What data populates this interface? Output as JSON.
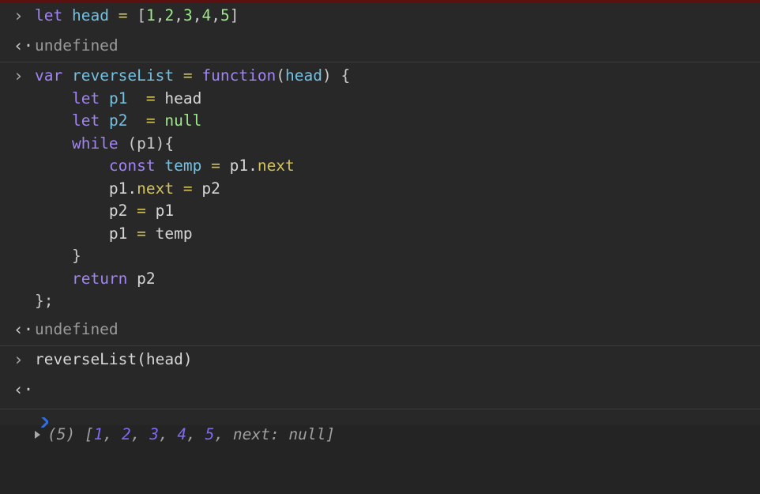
{
  "console": {
    "name": "javascript-console",
    "top_strip_color": "#5c1111",
    "background_color": "#282828",
    "divider_color": "#3b3b3b",
    "prompt_marker": "›",
    "result_marker": "‹·",
    "entries": [
      {
        "id": "entry-1-input",
        "kind": "input",
        "marker": "›",
        "text": "let head = [1,2,3,4,5]",
        "tokens": [
          {
            "t": "let",
            "c": "kw"
          },
          {
            "t": " ",
            "c": "plain"
          },
          {
            "t": "head",
            "c": "ident"
          },
          {
            "t": " ",
            "c": "plain"
          },
          {
            "t": "=",
            "c": "op"
          },
          {
            "t": " ",
            "c": "plain"
          },
          {
            "t": "[",
            "c": "punct"
          },
          {
            "t": "1",
            "c": "num"
          },
          {
            "t": ",",
            "c": "punct"
          },
          {
            "t": "2",
            "c": "num"
          },
          {
            "t": ",",
            "c": "punct"
          },
          {
            "t": "3",
            "c": "num"
          },
          {
            "t": ",",
            "c": "punct"
          },
          {
            "t": "4",
            "c": "num"
          },
          {
            "t": ",",
            "c": "punct"
          },
          {
            "t": "5",
            "c": "num"
          },
          {
            "t": "]",
            "c": "punct"
          }
        ]
      },
      {
        "id": "entry-1-result",
        "kind": "result",
        "marker": "‹·",
        "text": "undefined"
      },
      {
        "id": "entry-2-input",
        "kind": "input",
        "marker": "›",
        "text": "var reverseList = function(head) {\n    let p1  = head\n    let p2  = null\n    while (p1){\n        const temp = p1.next\n        p1.next = p2\n        p2 = p1\n        p1 = temp\n    }\n    return p2\n};",
        "lines": [
          {
            "tokens": [
              {
                "t": "var",
                "c": "kw"
              },
              {
                "t": " ",
                "c": "plain"
              },
              {
                "t": "reverseList",
                "c": "ident"
              },
              {
                "t": " ",
                "c": "plain"
              },
              {
                "t": "=",
                "c": "op"
              },
              {
                "t": " ",
                "c": "plain"
              },
              {
                "t": "function",
                "c": "kw"
              },
              {
                "t": "(",
                "c": "punct"
              },
              {
                "t": "head",
                "c": "ident"
              },
              {
                "t": ") {",
                "c": "punct"
              }
            ]
          },
          {
            "tokens": [
              {
                "t": "    ",
                "c": "plain"
              },
              {
                "t": "let",
                "c": "kw"
              },
              {
                "t": " ",
                "c": "plain"
              },
              {
                "t": "p1",
                "c": "ident"
              },
              {
                "t": "  ",
                "c": "plain"
              },
              {
                "t": "=",
                "c": "op"
              },
              {
                "t": " ",
                "c": "plain"
              },
              {
                "t": "head",
                "c": "plain"
              }
            ]
          },
          {
            "tokens": [
              {
                "t": "    ",
                "c": "plain"
              },
              {
                "t": "let",
                "c": "kw"
              },
              {
                "t": " ",
                "c": "plain"
              },
              {
                "t": "p2",
                "c": "ident"
              },
              {
                "t": "  ",
                "c": "plain"
              },
              {
                "t": "=",
                "c": "op"
              },
              {
                "t": " ",
                "c": "plain"
              },
              {
                "t": "null",
                "c": "nul"
              }
            ]
          },
          {
            "tokens": [
              {
                "t": "    ",
                "c": "plain"
              },
              {
                "t": "while",
                "c": "kw"
              },
              {
                "t": " ",
                "c": "plain"
              },
              {
                "t": "(p1){",
                "c": "punct"
              }
            ]
          },
          {
            "tokens": [
              {
                "t": "        ",
                "c": "plain"
              },
              {
                "t": "const",
                "c": "kw"
              },
              {
                "t": " ",
                "c": "plain"
              },
              {
                "t": "temp",
                "c": "ident"
              },
              {
                "t": " ",
                "c": "plain"
              },
              {
                "t": "=",
                "c": "op"
              },
              {
                "t": " ",
                "c": "plain"
              },
              {
                "t": "p1.",
                "c": "plain"
              },
              {
                "t": "next",
                "c": "prop"
              }
            ]
          },
          {
            "tokens": [
              {
                "t": "        ",
                "c": "plain"
              },
              {
                "t": "p1.",
                "c": "plain"
              },
              {
                "t": "next",
                "c": "prop"
              },
              {
                "t": " ",
                "c": "plain"
              },
              {
                "t": "=",
                "c": "op"
              },
              {
                "t": " ",
                "c": "plain"
              },
              {
                "t": "p2",
                "c": "plain"
              }
            ]
          },
          {
            "tokens": [
              {
                "t": "        ",
                "c": "plain"
              },
              {
                "t": "p2",
                "c": "plain"
              },
              {
                "t": " ",
                "c": "plain"
              },
              {
                "t": "=",
                "c": "op"
              },
              {
                "t": " ",
                "c": "plain"
              },
              {
                "t": "p1",
                "c": "plain"
              }
            ]
          },
          {
            "tokens": [
              {
                "t": "        ",
                "c": "plain"
              },
              {
                "t": "p1",
                "c": "plain"
              },
              {
                "t": " ",
                "c": "plain"
              },
              {
                "t": "=",
                "c": "op"
              },
              {
                "t": " ",
                "c": "plain"
              },
              {
                "t": "temp",
                "c": "plain"
              }
            ]
          },
          {
            "tokens": [
              {
                "t": "    ",
                "c": "plain"
              },
              {
                "t": "}",
                "c": "punct"
              }
            ]
          },
          {
            "tokens": [
              {
                "t": "    ",
                "c": "plain"
              },
              {
                "t": "return",
                "c": "kw"
              },
              {
                "t": " ",
                "c": "plain"
              },
              {
                "t": "p2",
                "c": "plain"
              }
            ]
          },
          {
            "tokens": [
              {
                "t": "};",
                "c": "punct"
              }
            ]
          }
        ]
      },
      {
        "id": "entry-2-result",
        "kind": "result",
        "marker": "‹·",
        "text": "undefined"
      },
      {
        "id": "entry-3-input",
        "kind": "input",
        "marker": "›",
        "text": "reverseList(head)",
        "tokens": [
          {
            "t": "reverseList(head)",
            "c": "plain"
          }
        ]
      },
      {
        "id": "entry-3-result",
        "kind": "object-result",
        "marker": "‹·",
        "expanded": false,
        "text": "(5) [1, 2, 3, 4, 5, next: null]",
        "count_label": "(5) ",
        "open_bracket": "[",
        "values": [
          "1",
          "2",
          "3",
          "4",
          "5"
        ],
        "separator": ", ",
        "extra_key": "next: ",
        "extra_value": "null",
        "close_bracket": "]",
        "number_color": "#7f6bf0",
        "text_color": "#a0a0a0"
      }
    ],
    "prompt": {
      "name": "live-prompt",
      "caret_color": "#2f6fe0",
      "value": ""
    }
  }
}
